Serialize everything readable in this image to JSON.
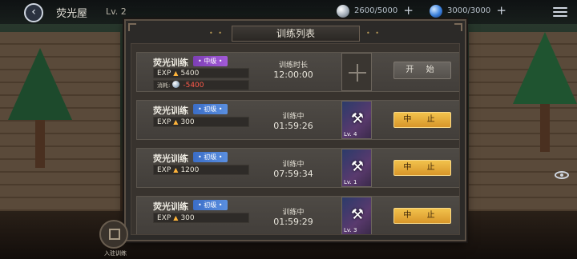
{
  "header": {
    "back_icon": "back-arrow-icon",
    "title": "荧光屋",
    "level": "Lv. 2",
    "resource1": {
      "icon": "silver-orb-icon",
      "value": "2600/5000",
      "color": "#b0b8c4"
    },
    "resource2": {
      "icon": "blue-orb-icon",
      "value": "3000/3000",
      "color": "#4a8fe8"
    },
    "menu_icon": "hamburger-menu-icon"
  },
  "panel": {
    "title": "训练列表",
    "rows": [
      {
        "name": "荧光训练",
        "tier": "• 中级 •",
        "exp_label": "EXP",
        "exp": "5400",
        "cost_label": "消耗:",
        "cost": "-5400",
        "timer_label": "训练时长",
        "timer": "12:00:00",
        "slot": "empty",
        "action": "开 始"
      },
      {
        "name": "荧光训练",
        "tier": "• 初级 •",
        "exp_label": "EXP",
        "exp": "300",
        "timer_label": "训练中",
        "timer": "01:59:26",
        "slot": "character",
        "slot_level": "Lv. 4",
        "action": "中 止"
      },
      {
        "name": "荧光训练",
        "tier": "• 初级 •",
        "exp_label": "EXP",
        "exp": "1200",
        "timer_label": "训练中",
        "timer": "07:59:34",
        "slot": "character",
        "slot_level": "Lv. 1",
        "action": "中 止"
      },
      {
        "name": "荧光训练",
        "tier": "• 初级 •",
        "exp_label": "EXP",
        "exp": "300",
        "timer_label": "训练中",
        "timer": "01:59:29",
        "slot": "character",
        "slot_level": "Lv. 3",
        "action": "中 止"
      }
    ]
  },
  "footer": {
    "building_label": "入驻训练",
    "building_icon": "building-icon",
    "eye_icon": "eye-icon"
  },
  "colors": {
    "mid_tier": "#9b52d4",
    "low_tier": "#4d84da",
    "stop_button": "#e8ac3a",
    "cost_negative": "#ff5a4a"
  }
}
